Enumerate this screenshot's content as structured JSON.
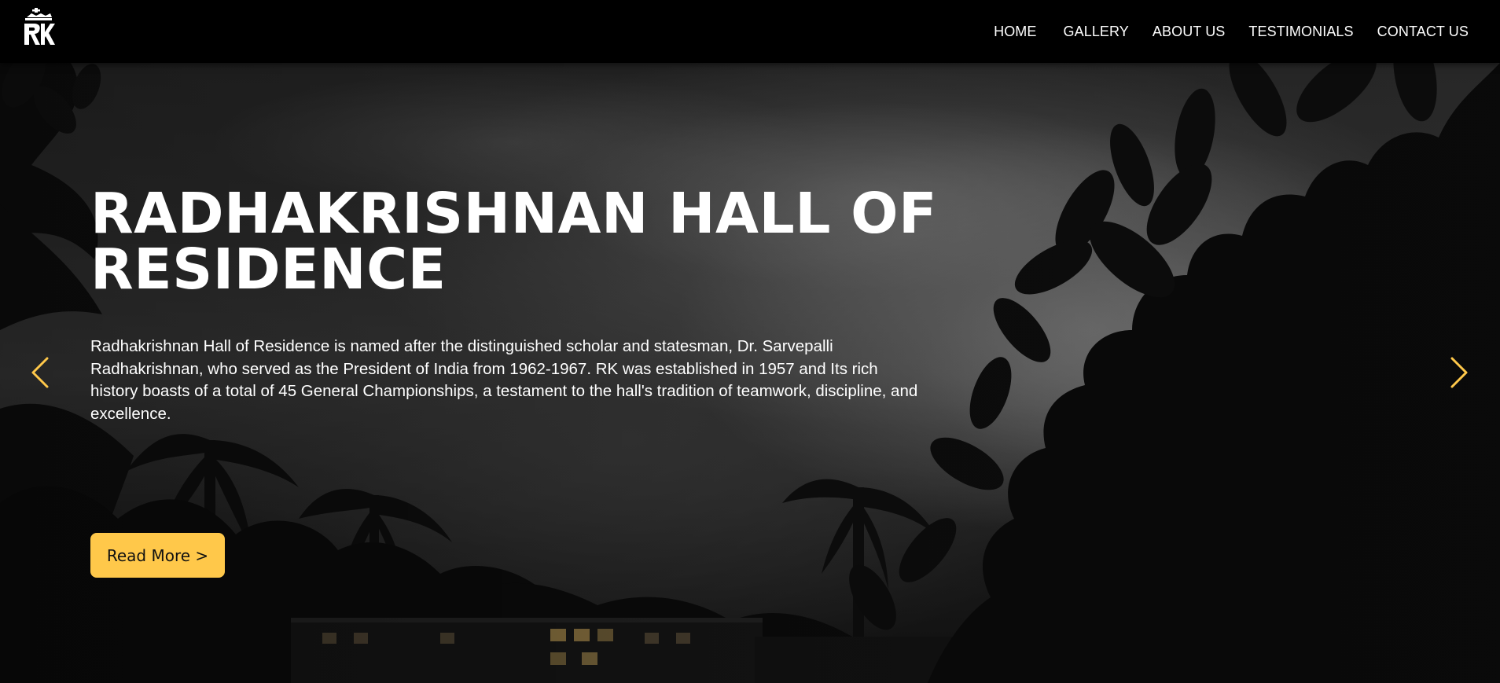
{
  "nav": {
    "logo_icon": "rk-crest-logo-icon",
    "items": [
      {
        "label": "HOME"
      },
      {
        "label": "GALLERY"
      },
      {
        "label": "ABOUT US"
      },
      {
        "label": "TESTIMONIALS"
      },
      {
        "label": "CONTACT US"
      }
    ]
  },
  "hero": {
    "title": "RADHAKRISHNAN HALL OF RESIDENCE",
    "description": "Radhakrishnan Hall of Residence is named after the distinguished scholar and statesman, Dr. Sarvepalli Radhakrishnan, who served as the President of India from 1962-1967. RK was established in 1957 and Its rich history boasts of a total of 45 General Championships, a testament to the hall's tradition of teamwork, discipline, and excellence.",
    "button_label": "Read More >",
    "prev_icon": "chevron-left-icon",
    "next_icon": "chevron-right-icon"
  },
  "colors": {
    "accent": "#ffc84a",
    "navbar_bg": "#000000",
    "text": "#ffffff"
  }
}
